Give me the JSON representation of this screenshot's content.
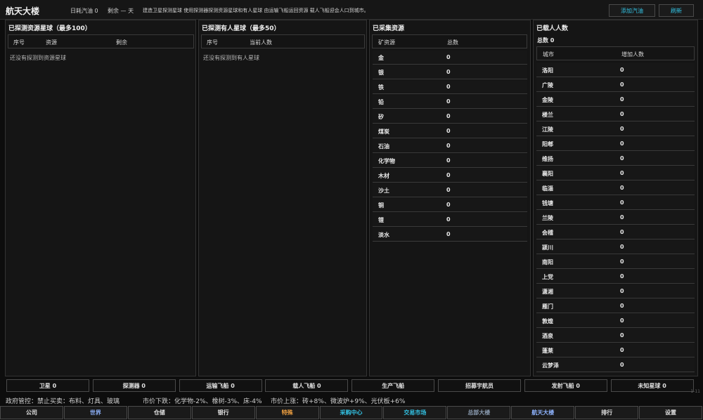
{
  "header": {
    "title": "航天大楼",
    "fuel_info": "日耗汽油 0",
    "remaining_info": "剩余 — 天",
    "hint": "建造卫星探测星球  使用探测器探测资源星球和有人星球  由运输飞船运回资源  载人飞船迎会人口到城市。",
    "add_fuel_label": "添加汽油",
    "refresh_label": "刷新"
  },
  "panels": {
    "resource_planets": {
      "title": "已探测资源星球（最多100）",
      "columns": [
        "序号",
        "资源",
        "剩余"
      ],
      "empty": "还没有探测到资源星球"
    },
    "inhabited_planets": {
      "title": "已探测有人星球（最多50）",
      "columns": [
        "序号",
        "当前人数"
      ],
      "empty": "还没有探测到有人星球"
    },
    "collected": {
      "title": "已采集资源",
      "columns": [
        "矿资源",
        "总数"
      ],
      "rows": [
        {
          "name": "金",
          "value": "0"
        },
        {
          "name": "银",
          "value": "0"
        },
        {
          "name": "铁",
          "value": "0"
        },
        {
          "name": "铅",
          "value": "0"
        },
        {
          "name": "矽",
          "value": "0"
        },
        {
          "name": "煤炭",
          "value": "0"
        },
        {
          "name": "石油",
          "value": "0"
        },
        {
          "name": "化学物",
          "value": "0"
        },
        {
          "name": "木材",
          "value": "0"
        },
        {
          "name": "沙土",
          "value": "0"
        },
        {
          "name": "铜",
          "value": "0"
        },
        {
          "name": "锂",
          "value": "0"
        },
        {
          "name": "淡水",
          "value": "0"
        }
      ]
    },
    "carried": {
      "title": "已载人人数",
      "total": "总数 0",
      "columns": [
        "城市",
        "增加人数"
      ],
      "rows": [
        {
          "name": "洛阳",
          "value": "0"
        },
        {
          "name": "广陵",
          "value": "0"
        },
        {
          "name": "金陵",
          "value": "0"
        },
        {
          "name": "楼兰",
          "value": "0"
        },
        {
          "name": "江陵",
          "value": "0"
        },
        {
          "name": "阳郫",
          "value": "0"
        },
        {
          "name": "维扬",
          "value": "0"
        },
        {
          "name": "襄阳",
          "value": "0"
        },
        {
          "name": "临淄",
          "value": "0"
        },
        {
          "name": "钱塘",
          "value": "0"
        },
        {
          "name": "兰陵",
          "value": "0"
        },
        {
          "name": "会稽",
          "value": "0"
        },
        {
          "name": "颍川",
          "value": "0"
        },
        {
          "name": "南阳",
          "value": "0"
        },
        {
          "name": "上党",
          "value": "0"
        },
        {
          "name": "潇湘",
          "value": "0"
        },
        {
          "name": "雁门",
          "value": "0"
        },
        {
          "name": "敦煌",
          "value": "0"
        },
        {
          "name": "酒泉",
          "value": "0"
        },
        {
          "name": "蓬莱",
          "value": "0"
        },
        {
          "name": "云梦泽",
          "value": "0"
        }
      ]
    }
  },
  "actions": [
    {
      "label": "卫星 0",
      "name": "satellite-button"
    },
    {
      "label": "探测器 0",
      "name": "probe-button"
    },
    {
      "label": "运输飞船 0",
      "name": "transport-ship-button"
    },
    {
      "label": "载人飞船 0",
      "name": "crewed-ship-button"
    },
    {
      "label": "生产飞船",
      "name": "produce-ship-button"
    },
    {
      "label": "招募宇航员",
      "name": "recruit-astronaut-button"
    },
    {
      "label": "发射飞船 0",
      "name": "launch-ship-button"
    },
    {
      "label": "未知星球 0",
      "name": "unknown-planet-button"
    }
  ],
  "corner_text": "1-11",
  "ticker": {
    "control": "政府管控：禁止买卖：布料、灯具、玻璃",
    "down": "市价下跌：化学物-2%、橡树-3%、床-4%",
    "up": "市价上涨：砖+8%、微波炉+9%、光伏板+6%"
  },
  "nav": [
    {
      "label": "公司",
      "color": "#e0e0e0"
    },
    {
      "label": "世界",
      "color": "#8fb4ff"
    },
    {
      "label": "仓储",
      "color": "#e0e0e0"
    },
    {
      "label": "银行",
      "color": "#e0e0e0"
    },
    {
      "label": "特殊",
      "color": "#f0a040"
    },
    {
      "label": "采购中心",
      "color": "#33c4e6"
    },
    {
      "label": "交易市场",
      "color": "#33c4e6"
    },
    {
      "label": "总部大楼",
      "color": "#8a9bb0"
    },
    {
      "label": "航天大楼",
      "color": "#8fb4ff"
    },
    {
      "label": "排行",
      "color": "#e0e0e0"
    },
    {
      "label": "设置",
      "color": "#e0e0e0"
    }
  ],
  "colors": {
    "accent": "#33c4e6",
    "special": "#f0a040",
    "world": "#8fb4ff"
  }
}
